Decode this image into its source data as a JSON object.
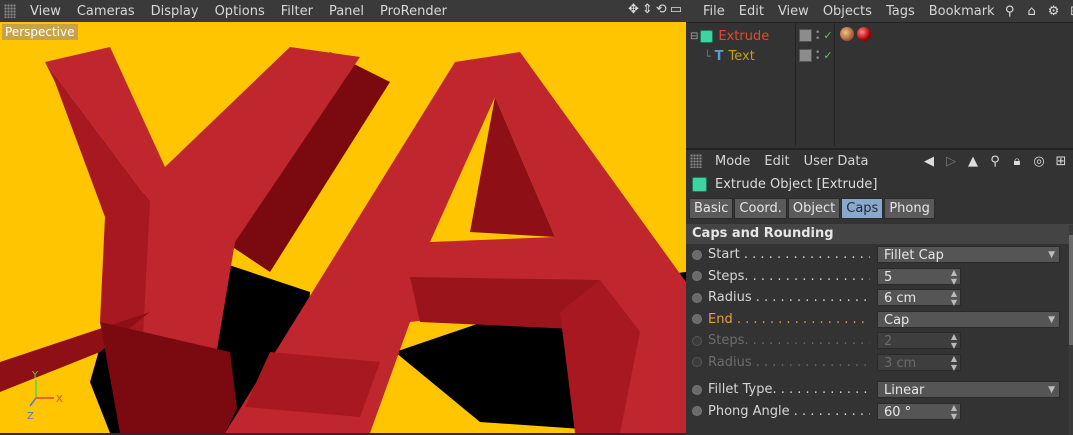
{
  "viewport": {
    "menu": [
      "View",
      "Cameras",
      "Display",
      "Options",
      "Filter",
      "Panel",
      "ProRender"
    ],
    "label": "Perspective",
    "axes": {
      "y": "Y",
      "x": "X",
      "z": "Z"
    },
    "background_color": "#fec500",
    "object_color": "#b5141c"
  },
  "object_manager": {
    "menu": [
      "File",
      "Edit",
      "View",
      "Objects",
      "Tags",
      "Bookmark"
    ],
    "objects": [
      {
        "name": "Extrude",
        "icon": "extrude-icon"
      },
      {
        "name": "Text",
        "icon": "text-spline-icon"
      }
    ]
  },
  "attributes": {
    "menu": [
      "Mode",
      "Edit",
      "User Data"
    ],
    "title": "Extrude Object [Extrude]",
    "tabs": [
      "Basic",
      "Coord.",
      "Object",
      "Caps",
      "Phong"
    ],
    "active_tab": "Caps",
    "section": "Caps and Rounding",
    "props": [
      {
        "label": "Start . . . . . . . . . . . . . . . . . . . . . .",
        "value": "Fillet Cap",
        "kind": "dropdown"
      },
      {
        "label": "Steps. . . . . . . . . . . . . . . . . . . . . .",
        "value": "5",
        "kind": "number"
      },
      {
        "label": "Radius . . . . . . . . . . . . . . . . . . . . .",
        "value": "6 cm",
        "kind": "number"
      },
      {
        "label": "End . . . . . . . . . . . . . . . . . . . . . . .",
        "value": "Cap",
        "kind": "dropdown"
      },
      {
        "label": "Steps. . . . . . . . . . . . . . . . . . . . . .",
        "value": "2",
        "kind": "number"
      },
      {
        "label": "Radius . . . . . . . . . . . . . . . . . . . . .",
        "value": "3 cm",
        "kind": "number"
      },
      {
        "label": "Fillet Type. . . . . . . . . . . . . . . . . . .",
        "value": "Linear",
        "kind": "dropdown"
      },
      {
        "label": "Phong Angle . . . . . . . . . . . . . . . . .",
        "value": "60 °",
        "kind": "number"
      }
    ]
  }
}
